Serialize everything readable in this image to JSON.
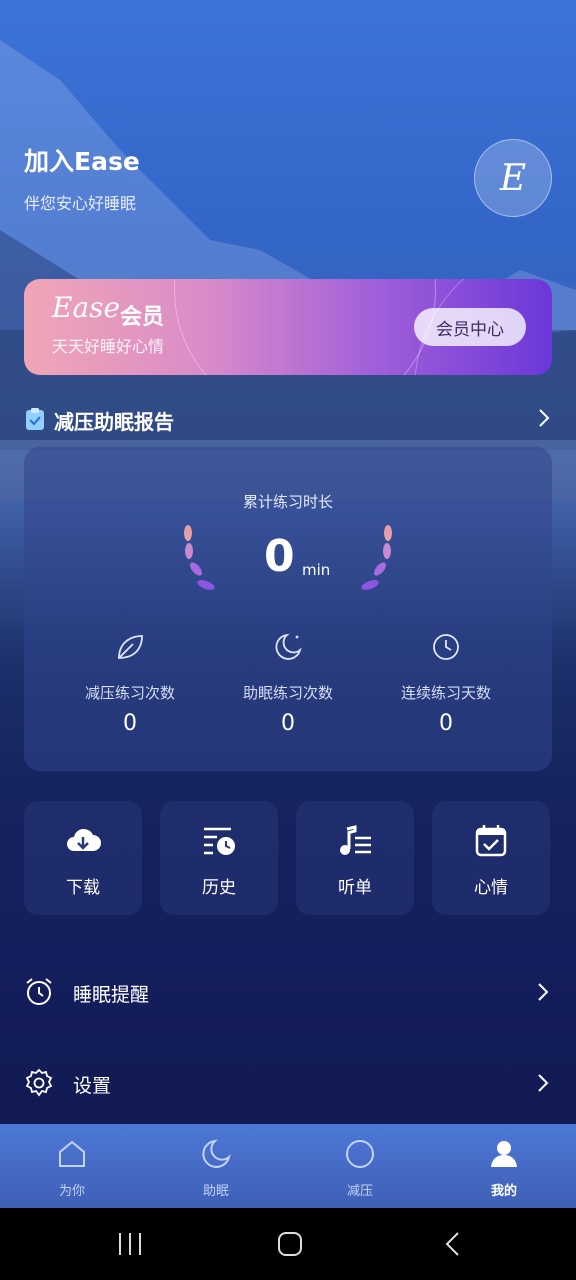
{
  "header": {
    "title": "加入Ease",
    "subtitle": "伴您安心好睡眠",
    "avatar_letter": "E"
  },
  "member_card": {
    "brand": "Ease",
    "label": "会员",
    "slogan": "天天好睡好心情",
    "button": "会员中心"
  },
  "report": {
    "title": "减压助眠报告",
    "total_label": "累计练习时长",
    "total_value": "0",
    "total_unit": "min",
    "stats": [
      {
        "icon": "leaf-icon",
        "label": "减压练习次数",
        "value": "0"
      },
      {
        "icon": "moon-icon",
        "label": "助眠练习次数",
        "value": "0"
      },
      {
        "icon": "clock-icon",
        "label": "连续练习天数",
        "value": "0"
      }
    ]
  },
  "quick_actions": [
    {
      "icon": "cloud-download-icon",
      "label": "下载"
    },
    {
      "icon": "history-icon",
      "label": "历史"
    },
    {
      "icon": "playlist-icon",
      "label": "听单"
    },
    {
      "icon": "calendar-check-icon",
      "label": "心情"
    }
  ],
  "menu": [
    {
      "icon": "alarm-icon",
      "label": "睡眠提醒"
    },
    {
      "icon": "gear-icon",
      "label": "设置"
    }
  ],
  "tabs": [
    {
      "icon": "home-icon",
      "label": "为你"
    },
    {
      "icon": "moon-icon",
      "label": "助眠"
    },
    {
      "icon": "circle-icon",
      "label": "减压"
    },
    {
      "icon": "user-icon",
      "label": "我的",
      "active": true
    }
  ],
  "colors": {
    "accent": "#6b37d9",
    "tabbar": "#4d78d6",
    "card": "#32468c"
  }
}
